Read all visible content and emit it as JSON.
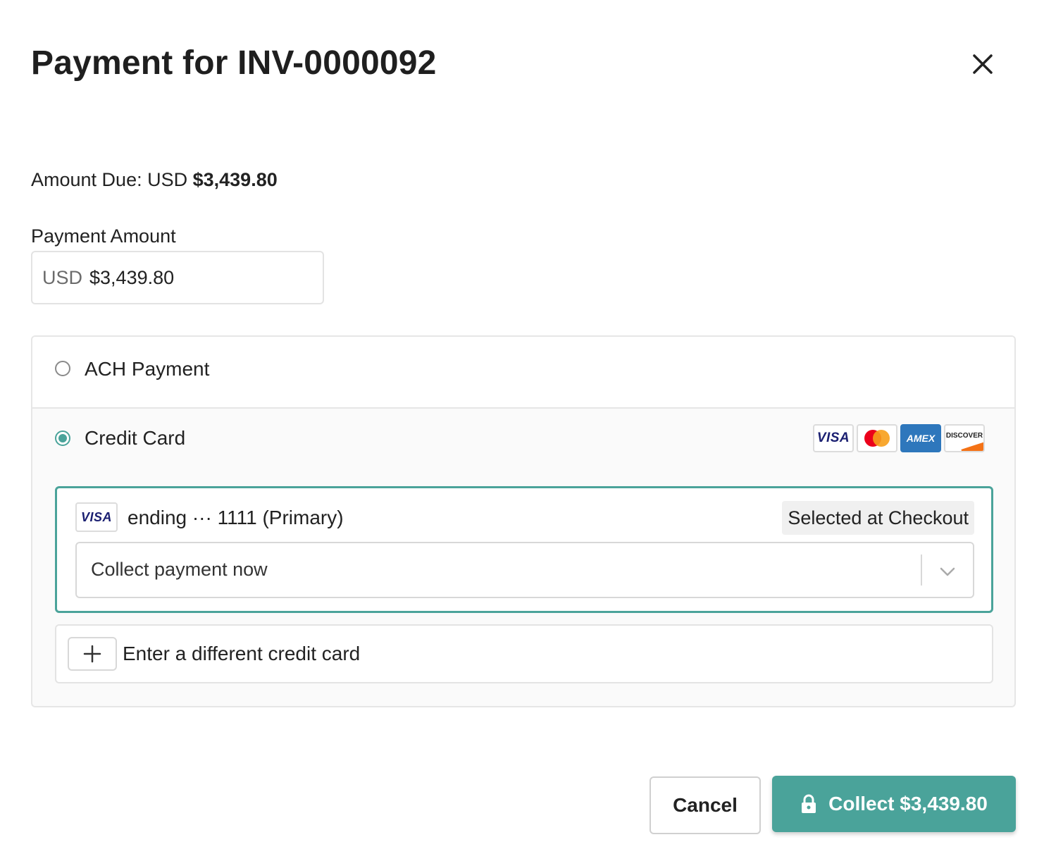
{
  "header": {
    "title": "Payment for INV-0000092"
  },
  "amount_due": {
    "label": "Amount Due: USD",
    "value": "$3,439.80"
  },
  "payment_amount": {
    "label": "Payment Amount",
    "currency": "USD",
    "value": "$3,439.80"
  },
  "methods": {
    "ach": {
      "label": "ACH Payment",
      "selected": false
    },
    "credit_card": {
      "label": "Credit Card",
      "selected": true,
      "logos": {
        "visa": "VISA",
        "amex": "AMEX",
        "discover": "DISCOVER"
      },
      "saved_card": {
        "brand": "VISA",
        "text": "ending ··· 1111 (Primary)",
        "badge": "Selected at Checkout",
        "action_select": "Collect payment now"
      },
      "new_card_label": "Enter a different credit card"
    }
  },
  "footer": {
    "cancel_label": "Cancel",
    "collect_label": "Collect $3,439.80"
  },
  "colors": {
    "accent": "#4aa39a",
    "visa_blue": "#1a1f71",
    "amex_blue": "#2e77bc",
    "discover_orange": "#f47216"
  }
}
